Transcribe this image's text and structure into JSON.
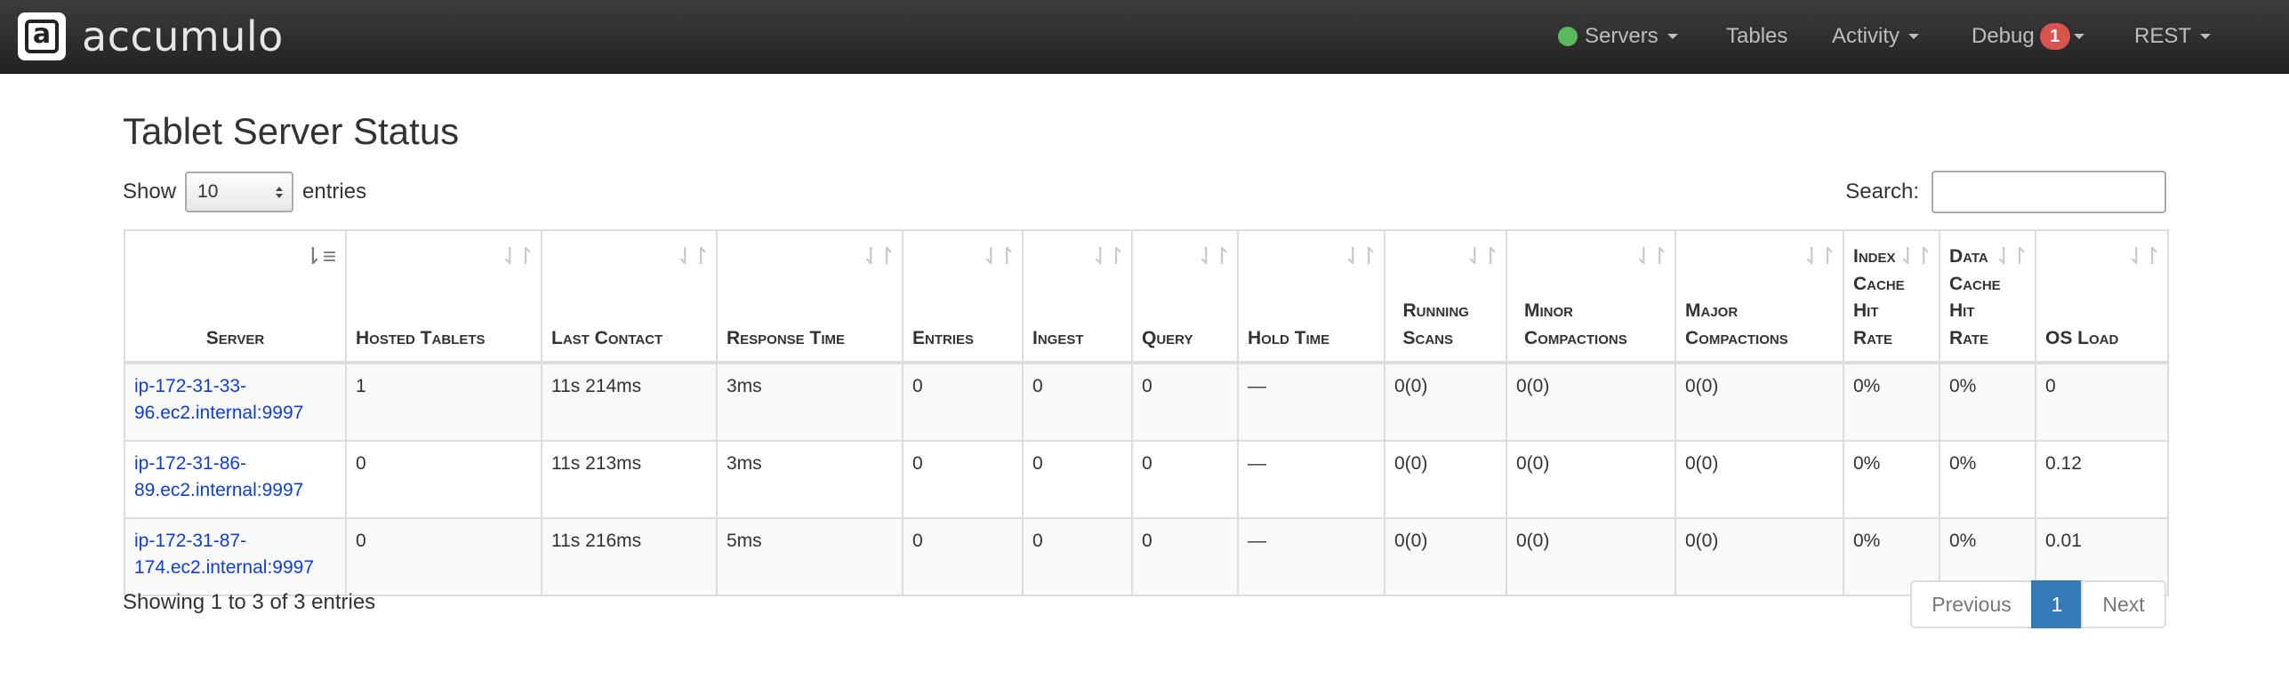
{
  "brand": {
    "logo_letter": "a",
    "name": "accumulo"
  },
  "nav": {
    "servers_label": "Servers",
    "servers_status_color": "#5cb85c",
    "tables_label": "Tables",
    "activity_label": "Activity",
    "debug_label": "Debug",
    "debug_badge": "1",
    "rest_label": "REST"
  },
  "page": {
    "title": "Tablet Server Status"
  },
  "length": {
    "show_label": "Show",
    "value": "10",
    "entries_label": "entries"
  },
  "search": {
    "label": "Search:",
    "value": "",
    "placeholder": ""
  },
  "table": {
    "headers": {
      "server": "Server",
      "hosted_tablets": "Hosted Tablets",
      "last_contact": "Last Contact",
      "response_time": "Response Time",
      "entries": "Entries",
      "ingest": "Ingest",
      "query": "Query",
      "hold_time": "Hold Time",
      "running_scans": "Running Scans",
      "minor_compactions": "Minor Compactions",
      "major_compactions": "Major Compactions",
      "index_cache_hit_rate": "Index Cache Hit Rate",
      "data_cache_hit_rate": "Data Cache Hit Rate",
      "os_load": "OS Load"
    },
    "rows": [
      {
        "server": "ip-172-31-33-96.ec2.internal:9997",
        "hosted_tablets": "1",
        "last_contact": "11s 214ms",
        "response_time": "3ms",
        "entries": "0",
        "ingest": "0",
        "query": "0",
        "hold_time": "—",
        "running_scans": "0(0)",
        "minor_compactions": "0(0)",
        "major_compactions": "0(0)",
        "index_cache_hit_rate": "0%",
        "data_cache_hit_rate": "0%",
        "os_load": "0"
      },
      {
        "server": "ip-172-31-86-89.ec2.internal:9997",
        "hosted_tablets": "0",
        "last_contact": "11s 213ms",
        "response_time": "3ms",
        "entries": "0",
        "ingest": "0",
        "query": "0",
        "hold_time": "—",
        "running_scans": "0(0)",
        "minor_compactions": "0(0)",
        "major_compactions": "0(0)",
        "index_cache_hit_rate": "0%",
        "data_cache_hit_rate": "0%",
        "os_load": "0.12"
      },
      {
        "server": "ip-172-31-87-174.ec2.internal:9997",
        "hosted_tablets": "0",
        "last_contact": "11s 216ms",
        "response_time": "5ms",
        "entries": "0",
        "ingest": "0",
        "query": "0",
        "hold_time": "—",
        "running_scans": "0(0)",
        "minor_compactions": "0(0)",
        "major_compactions": "0(0)",
        "index_cache_hit_rate": "0%",
        "data_cache_hit_rate": "0%",
        "os_load": "0.01"
      }
    ]
  },
  "footer": {
    "info": "Showing 1 to 3 of 3 entries",
    "previous_label": "Previous",
    "current_page": "1",
    "next_label": "Next"
  }
}
